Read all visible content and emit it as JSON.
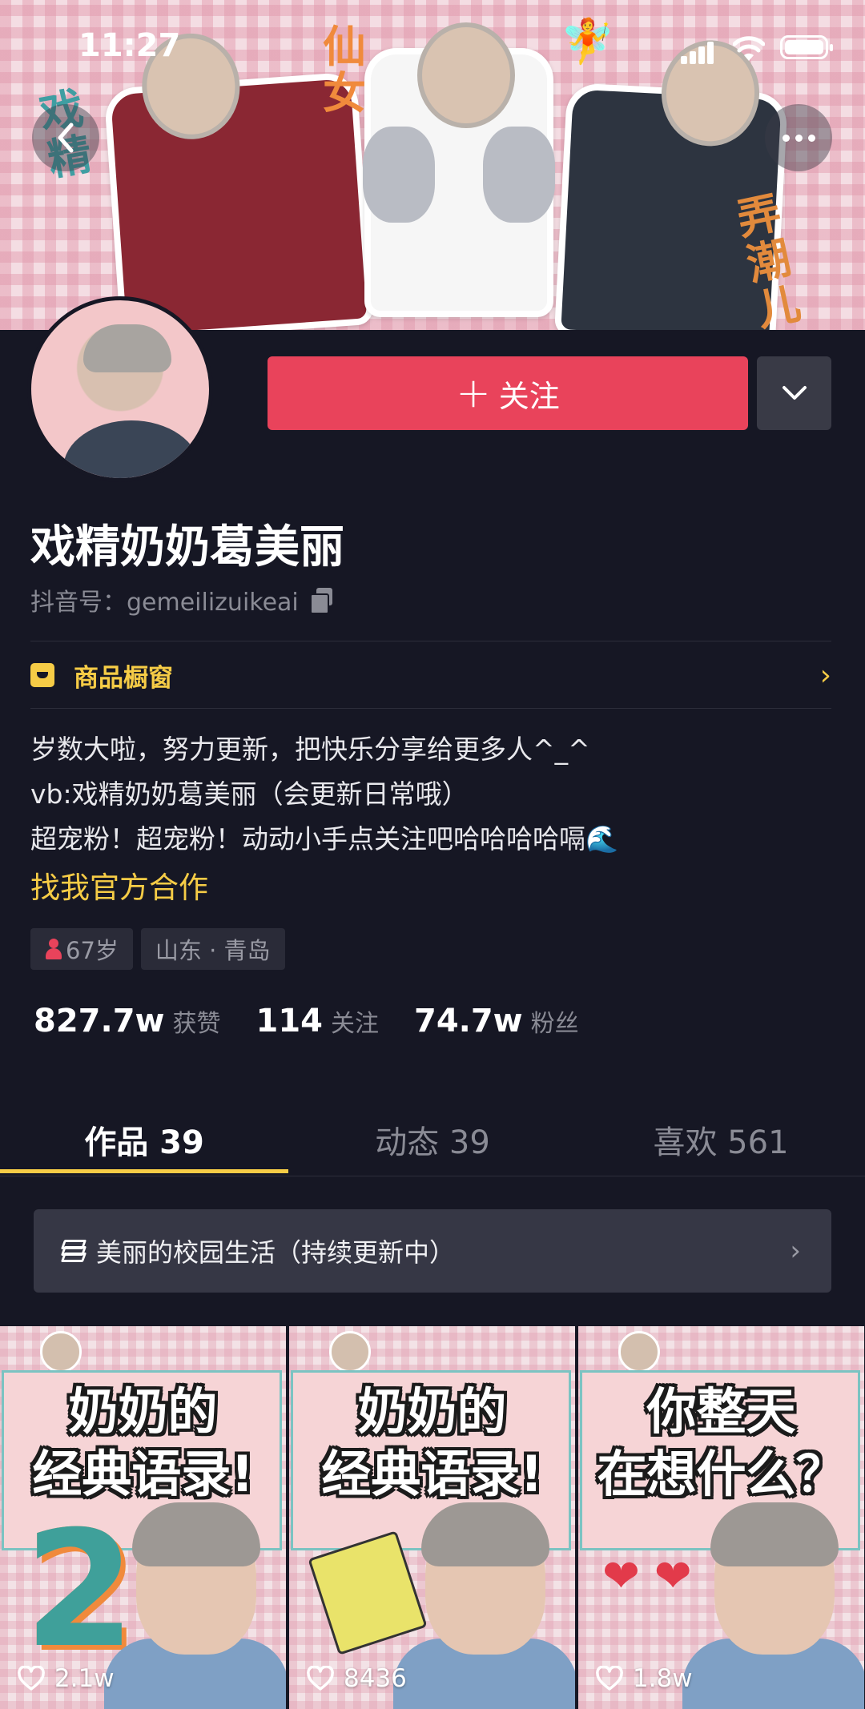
{
  "status_bar": {
    "time": "11:27"
  },
  "banner": {
    "stickers": [
      "戏精",
      "仙女",
      "弄潮儿"
    ]
  },
  "profile": {
    "follow_label": "关注",
    "name": "戏精奶奶葛美丽",
    "douyin_id_label": "抖音号：",
    "douyin_id": "gemeilizuikeai",
    "shop_label": "商品橱窗",
    "bio": [
      "岁数大啦，努力更新，把快乐分享给更多人^_^",
      "vb:戏精奶奶葛美丽（会更新日常哦）",
      "超宠粉！超宠粉！动动小手点关注吧哈哈哈哈嗝🌊"
    ],
    "contact_link": "找我官方合作",
    "tags": {
      "age": "67岁",
      "location": "山东 · 青岛"
    },
    "stats": [
      {
        "value": "827.7w",
        "label": "获赞"
      },
      {
        "value": "114",
        "label": "关注"
      },
      {
        "value": "74.7w",
        "label": "粉丝"
      }
    ]
  },
  "tabs": [
    {
      "label": "作品 39",
      "active": true
    },
    {
      "label": "动态 39",
      "active": false
    },
    {
      "label": "喜欢 561",
      "active": false
    }
  ],
  "collection": {
    "title": "美丽的校园生活（持续更新中）"
  },
  "videos": [
    {
      "title_line1": "奶奶的",
      "title_line2": "经典语录!",
      "likes": "2.1w",
      "badge": "2"
    },
    {
      "title_line1": "奶奶的",
      "title_line2": "经典语录!",
      "likes": "8436"
    },
    {
      "title_line1": "你整天",
      "title_line2": "在想什么？",
      "likes": "1.8w"
    }
  ],
  "colors": {
    "accent_red": "#e9435b",
    "accent_yellow": "#f6cc46",
    "background": "#161724"
  },
  "icons": [
    "back-icon",
    "more-icon",
    "chevron-down-icon",
    "copy-icon",
    "shop-icon",
    "chevron-right-icon",
    "female-icon",
    "layers-icon",
    "heart-icon"
  ]
}
